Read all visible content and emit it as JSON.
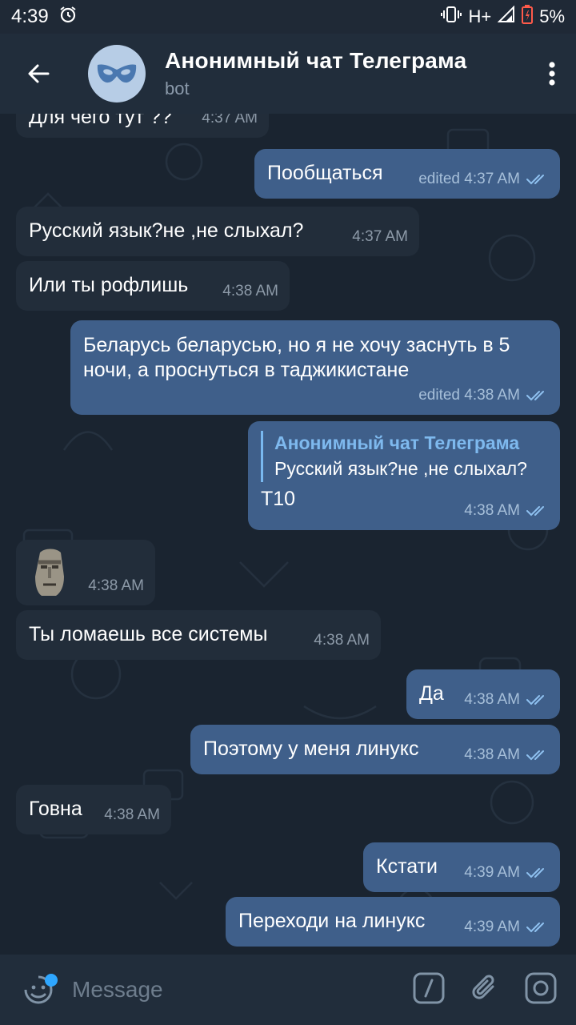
{
  "status_bar": {
    "time": "4:39",
    "network": "H+",
    "battery": "5%"
  },
  "header": {
    "title": "Анонимный чат Телеграма",
    "subtitle": "bot"
  },
  "messages": [
    {
      "dir": "in",
      "text": "Для чего тут ??",
      "time": "4:37 AM"
    },
    {
      "dir": "out",
      "text": "Пообщаться",
      "time": "edited 4:37 AM"
    },
    {
      "dir": "in",
      "text": "Русский язык?не ,не слыхал?",
      "time": "4:37 AM"
    },
    {
      "dir": "in",
      "text": "Или ты рофлишь",
      "time": "4:38 AM"
    },
    {
      "dir": "out",
      "text": "Беларусь беларусью, но я не хочу заснуть в 5 ночи, а проснуться в таджикистане",
      "time": "edited 4:38 AM"
    },
    {
      "dir": "out",
      "reply_name": "Анонимный чат Телеграма",
      "reply_text": "Русский язык?не ,не слыхал?",
      "text": "Т10",
      "time": "4:38 AM"
    },
    {
      "dir": "in",
      "sticker": "moai-emoji",
      "time": "4:38 AM"
    },
    {
      "dir": "in",
      "text": "Ты ломаешь все системы",
      "time": "4:38 AM"
    },
    {
      "dir": "out",
      "text": "Да",
      "time": "4:38 AM"
    },
    {
      "dir": "out",
      "text": "Поэтому у меня линукс",
      "time": "4:38 AM"
    },
    {
      "dir": "in",
      "text": "Говна",
      "time": "4:38 AM"
    },
    {
      "dir": "out",
      "text": "Кстати",
      "time": "4:39 AM"
    },
    {
      "dir": "out",
      "text": "Переходи на линукс",
      "time": "4:39 AM"
    }
  ],
  "input": {
    "placeholder": "Message"
  },
  "colors": {
    "incoming": "#222d3a",
    "outgoing": "#3f5f8a",
    "accent": "#2ea6ff",
    "reply_accent": "#79b8ef"
  }
}
